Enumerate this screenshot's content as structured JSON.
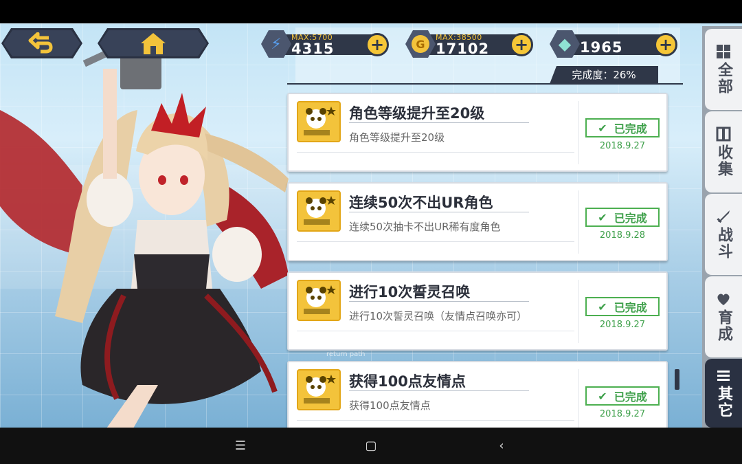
{
  "header": {
    "back_icon": "back-arrow-icon",
    "home_icon": "home-icon"
  },
  "currencies": [
    {
      "name": "stamina",
      "icon": "battery-icon",
      "max": "MAX:5700",
      "value": "4315",
      "color": "#4a8be6"
    },
    {
      "name": "gold",
      "icon": "gold-coin-icon",
      "max": "MAX:38500",
      "value": "17102",
      "color": "#f3c33b"
    },
    {
      "name": "gems",
      "icon": "crystal-icon",
      "max": "",
      "value": "1965",
      "color": "#7fd3c2"
    }
  ],
  "completion": {
    "text": "完成度：26%"
  },
  "achievements": [
    {
      "title": "角色等级提升至20级",
      "desc": "角色等级提升至20级",
      "status": "已完成",
      "date": "2018.9.27"
    },
    {
      "title": "连续50次不出UR角色",
      "desc": "连续50次抽卡不出UR稀有度角色",
      "status": "已完成",
      "date": "2018.9.28"
    },
    {
      "title": "进行10次誓灵召唤",
      "desc": "进行10次誓灵召唤（友情点召唤亦可）",
      "status": "已完成",
      "date": "2018.9.27"
    },
    {
      "title": "获得100点友情点",
      "desc": "获得100点友情点",
      "status": "已完成",
      "date": "2018.9.27"
    }
  ],
  "tabs": [
    {
      "label": "全部",
      "icon": "grid-icon",
      "active": false
    },
    {
      "label": "收集",
      "icon": "collection-icon",
      "active": false
    },
    {
      "label": "战斗",
      "icon": "sword-icon",
      "active": false
    },
    {
      "label": "育成",
      "icon": "heart-icon",
      "active": false
    },
    {
      "label": "其它",
      "icon": "menu-icon",
      "active": true
    }
  ],
  "background_text": "return path",
  "system_nav": {
    "menu": "☰",
    "home": "▢",
    "back": "‹"
  }
}
